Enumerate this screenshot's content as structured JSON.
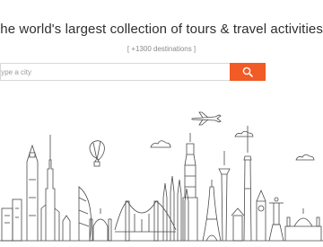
{
  "hero": {
    "headline": "the world's largest collection of tours & travel activities",
    "subline": "[ +1300 destinations ]"
  },
  "search": {
    "placeholder": "type a city",
    "button_icon": "search-icon",
    "button_color": "#f25a26"
  },
  "illustration": {
    "name": "world-landmarks-skyline",
    "stroke_color": "#4a4a4a"
  }
}
